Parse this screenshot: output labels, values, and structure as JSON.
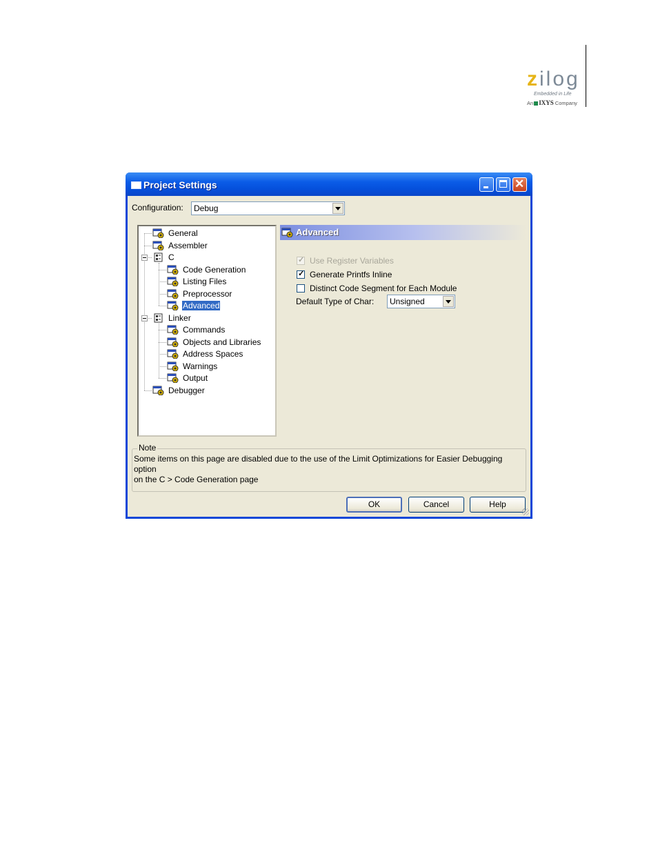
{
  "logo": {
    "word_first": "z",
    "word_rest": "ilog",
    "tagline": "Embedded in Life",
    "company_prefix": "An",
    "company_name": "IXYS",
    "company_suffix": "Company"
  },
  "window": {
    "title": "Project Settings",
    "configuration_label": "Configuration:",
    "configuration_value": "Debug"
  },
  "tree": {
    "items": [
      {
        "label": "General",
        "icon": "settings-page-icon"
      },
      {
        "label": "Assembler",
        "icon": "settings-page-icon"
      },
      {
        "label": "C",
        "icon": "folder-group-icon"
      },
      {
        "label": "Code Generation",
        "icon": "settings-page-icon"
      },
      {
        "label": "Listing Files",
        "icon": "settings-page-icon"
      },
      {
        "label": "Preprocessor",
        "icon": "settings-page-icon"
      },
      {
        "label": "Advanced",
        "icon": "settings-page-icon",
        "selected": true
      },
      {
        "label": "Linker",
        "icon": "folder-group-icon"
      },
      {
        "label": "Commands",
        "icon": "settings-page-icon"
      },
      {
        "label": "Objects and Libraries",
        "icon": "settings-page-icon"
      },
      {
        "label": "Address Spaces",
        "icon": "settings-page-icon"
      },
      {
        "label": "Warnings",
        "icon": "settings-page-icon"
      },
      {
        "label": "Output",
        "icon": "settings-page-icon"
      },
      {
        "label": "Debugger",
        "icon": "settings-page-icon"
      }
    ]
  },
  "panel": {
    "title": "Advanced",
    "options": [
      {
        "label": "Use Register Variables",
        "checked": true,
        "disabled": true
      },
      {
        "label": "Generate Printfs Inline",
        "checked": true,
        "disabled": false
      },
      {
        "label": "Distinct Code Segment for Each Module",
        "checked": false,
        "disabled": false
      }
    ],
    "char_label": "Default Type of Char:",
    "char_value": "Unsigned"
  },
  "note": {
    "legend": "Note",
    "line1": "Some items on this page are disabled due to the use of the Limit Optimizations for Easier Debugging option",
    "line2": "on the C > Code Generation page"
  },
  "buttons": {
    "ok": "OK",
    "cancel": "Cancel",
    "help": "Help"
  },
  "colors": {
    "titlebar": "#0550dc",
    "selection": "#316ac5",
    "dialog_face": "#ece9d8",
    "logo_accent": "#e6b417"
  }
}
